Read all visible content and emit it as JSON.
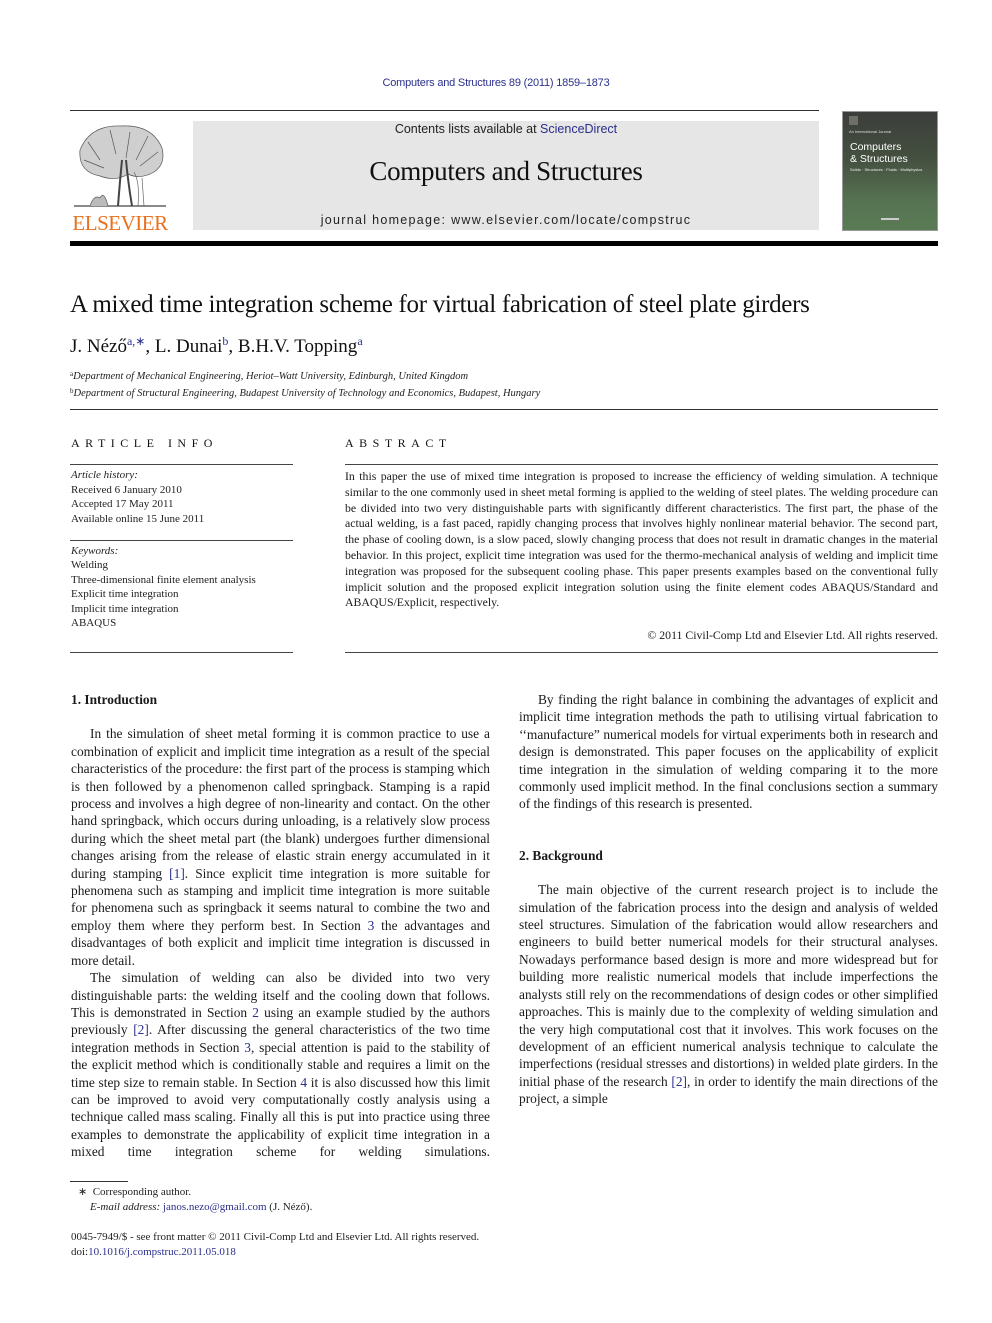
{
  "header": {
    "journal_reference": "Computers and Structures 89 (2011) 1859–1873",
    "contents_prefix": "Contents lists available at ",
    "contents_link": "ScienceDirect",
    "journal_title": "Computers and Structures",
    "homepage": "journal homepage: www.elsevier.com/locate/compstruc",
    "publisher_logo_text": "ELSEVIER",
    "cover": {
      "small_text": "An International Journal",
      "title_line1": "Computers",
      "title_line2": "& Structures",
      "subtitle": "Solids · Structures · Fluids · Multiphysics"
    },
    "colors": {
      "link": "#2a2f8c",
      "elsevier_orange": "#e9711c",
      "banner_bg": "#e6e6e6"
    }
  },
  "article": {
    "title": "A mixed time integration scheme for virtual fabrication of steel plate girders",
    "authors": [
      {
        "name": "J. Néző",
        "sup": "a,∗",
        "sep": ", "
      },
      {
        "name": "L. Dunai",
        "sup": "b",
        "sep": ", "
      },
      {
        "name": "B.H.V. Topping",
        "sup": "a",
        "sep": ""
      }
    ],
    "affiliations": [
      {
        "sup": "a",
        "text": "Department of Mechanical Engineering, Heriot–Watt University, Edinburgh, United Kingdom"
      },
      {
        "sup": "b",
        "text": "Department of Structural Engineering, Budapest University of Technology and Economics, Budapest, Hungary"
      }
    ]
  },
  "article_info": {
    "heading": "ARTICLE INFO",
    "history_label": "Article history:",
    "history": [
      "Received 6 January 2010",
      "Accepted 17 May 2011",
      "Available online 15 June 2011"
    ],
    "keywords_label": "Keywords:",
    "keywords": [
      "Welding",
      "Three-dimensional finite element analysis",
      "Explicit time integration",
      "Implicit time integration",
      "ABAQUS"
    ]
  },
  "abstract": {
    "heading": "ABSTRACT",
    "text": "In this paper the use of mixed time integration is proposed to increase the efficiency of welding simulation. A technique similar to the one commonly used in sheet metal forming is applied to the welding of steel plates. The welding procedure can be divided into two very distinguishable parts with significantly different characteristics. The first part, the phase of the actual welding, is a fast paced, rapidly changing process that involves highly nonlinear material behavior. The second part, the phase of cooling down, is a slow paced, slowly changing process that does not result in dramatic changes in the material behavior. In this project, explicit time integration was used for the thermo-mechanical analysis of welding and implicit time integration was proposed for the subsequent cooling phase. This paper presents examples based on the conventional fully implicit solution and the proposed explicit integration solution using the finite element codes ABAQUS/Standard and ABAQUS/Explicit, respectively.",
    "copyright": "© 2011 Civil-Comp Ltd and Elsevier Ltd. All rights reserved."
  },
  "body": {
    "section1": {
      "heading": "1. Introduction",
      "p1_a": "In the simulation of sheet metal forming it is common practice to use a combination of explicit and implicit time integration as a result of the special characteristics of the procedure: the first part of the process is stamping which is then followed by a phenomenon called springback. Stamping is a rapid process and involves a high degree of non-linearity and contact. On the other hand springback, which occurs during unloading, is a relatively slow process during which the sheet metal part (the blank) undergoes further dimensional changes arising from the release of elastic strain energy accumulated in it during stamping ",
      "p1_ref1": "[1]",
      "p1_b": ". Since explicit time integration is more suitable for phenomena such as stamping and implicit time integration is more suitable for phenomena such as springback it seems natural to combine the two and employ them where they perform best. In Section ",
      "p1_sec3": "3",
      "p1_c": " the advantages and disadvantages of both explicit and implicit time integration is discussed in more detail.",
      "p2_a": "The simulation of welding can also be divided into two very distinguishable parts: the welding itself and the cooling down that follows. This is demonstrated in Section ",
      "p2_sec2": "2",
      "p2_b": " using an example studied by the authors previously ",
      "p2_ref2": "[2]",
      "p2_c": ". After discussing the general characteristics of the two time integration methods in Section ",
      "p2_sec3": "3",
      "p2_d": ", special attention is paid to the stability of the explicit method which is conditionally stable and requires a limit on the time step size to remain stable. In Section ",
      "p2_sec4": "4",
      "p2_e": " it is also discussed how this limit can be improved to avoid very computationally costly analysis using a technique called mass scaling. Finally all this is put into practice using three examples to demonstrate the applicability of explicit time integration in a mixed time integration scheme for welding simulations.",
      "p3": "By finding the right balance in combining the advantages of explicit and implicit time integration methods the path to utilising virtual fabrication to ‘‘manufacture” numerical models for virtual experiments both in research and design is demonstrated. This paper focuses on the applicability of explicit time integration in the simulation of welding comparing it to the more commonly used implicit method. In the final conclusions section a summary of the findings of this research is presented."
    },
    "section2": {
      "heading": "2. Background",
      "p1_a": "The main objective of the current research project is to include the simulation of the fabrication process into the design and analysis of welded steel structures. Simulation of the fabrication would allow researchers and engineers to build better numerical models for their structural analyses. Nowadays performance based design is more and more widespread but for building more realistic numerical models that include imperfections the analysts still rely on the recommendations of design codes or other simplified approaches. This is mainly due to the complexity of welding simulation and the very high computational cost that it involves. This work focuses on the development of an efficient numerical analysis technique to calculate the imperfections (residual stresses and distortions) in welded plate girders. In the initial phase of the research ",
      "p1_ref2": "[2]",
      "p1_b": ", in order to identify the main directions of the project, a simple"
    }
  },
  "footnotes": {
    "star": "∗",
    "corresponding": "Corresponding author.",
    "email_label": "E-mail address:",
    "email": "janos.nezo@gmail.com",
    "email_suffix": " (J. Néző).",
    "issn_line": "0045-7949/$ - see front matter © 2011 Civil-Comp Ltd and Elsevier Ltd. All rights reserved.",
    "doi_prefix": "doi:",
    "doi": "10.1016/j.compstruc.2011.05.018"
  }
}
